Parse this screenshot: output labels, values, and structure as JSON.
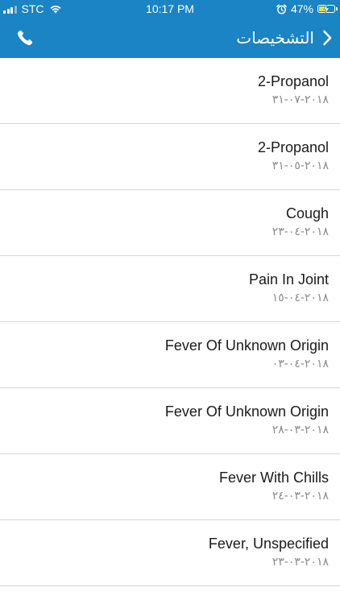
{
  "status_bar": {
    "carrier": "STC",
    "time": "10:17 PM",
    "battery_percent": "47%",
    "battery_level": 0.47,
    "signal_bars": 3,
    "icons": [
      "signal-icon",
      "wifi-icon",
      "alarm-icon",
      "battery-icon",
      "charging-bolt-icon"
    ]
  },
  "header": {
    "title": "التشخيصات",
    "background_color": "#1a84c4",
    "icons": [
      "phone-icon",
      "back-chevron-icon"
    ]
  },
  "diagnoses": [
    {
      "name": "2-Propanol",
      "date": "٢٠١٨-٠٧-٣١"
    },
    {
      "name": "2-Propanol",
      "date": "٢٠١٨-٠٥-٣١"
    },
    {
      "name": "Cough",
      "date": "٢٠١٨-٠٤-٢٣"
    },
    {
      "name": "Pain In Joint",
      "date": "٢٠١٨-٠٤-١٥"
    },
    {
      "name": "Fever Of Unknown Origin",
      "date": "٢٠١٨-٠٤-٠٣"
    },
    {
      "name": "Fever Of Unknown Origin",
      "date": "٢٠١٨-٠٣-٢٨"
    },
    {
      "name": "Fever With Chills",
      "date": "٢٠١٨-٠٣-٢٤"
    },
    {
      "name": "Fever, Unspecified",
      "date": "٢٠١٨-٠٣-٢٣"
    }
  ]
}
